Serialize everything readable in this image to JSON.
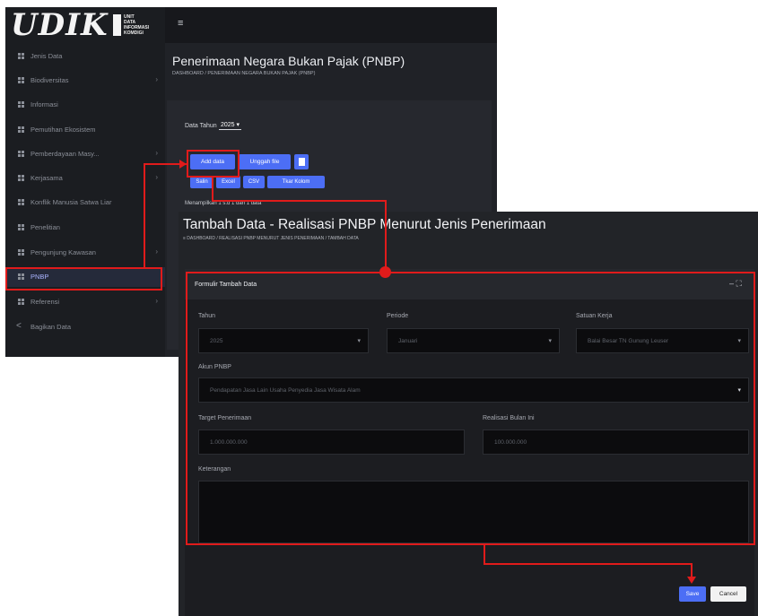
{
  "back": {
    "logo": {
      "text": "UDIK",
      "sub": [
        "UNIT",
        "DATA",
        "INFORMASI",
        "KOMDIGI"
      ]
    },
    "sidebar": {
      "items": [
        {
          "label": "Jenis Data",
          "icon": "grid-icon"
        },
        {
          "label": "Biodiversitas",
          "icon": "grid-icon",
          "chevron": "›"
        },
        {
          "label": "Informasi",
          "icon": "grid-icon"
        },
        {
          "label": "Pemutihan Ekosistem",
          "icon": "grid-icon"
        },
        {
          "label": "Pemberdayaan Masy...",
          "icon": "grid-icon",
          "chevron": "›"
        },
        {
          "label": "Kerjasama",
          "icon": "grid-icon",
          "chevron": "›"
        },
        {
          "label": "Konflik Manusia Satwa Liar",
          "icon": "grid-icon"
        },
        {
          "label": "Penelitian",
          "icon": "grid-icon"
        },
        {
          "label": "Pengunjung Kawasan",
          "icon": "grid-icon",
          "chevron": "›"
        },
        {
          "label": "PNBP",
          "icon": "grid-icon"
        },
        {
          "label": "Referensi",
          "icon": "grid-icon",
          "chevron": "›"
        },
        {
          "label": "Bagikan Data",
          "icon": "share-icon"
        }
      ]
    },
    "topbar": {
      "menu_icon": "≡"
    },
    "title": "Penerimaan Negara Bukan Pajak (PNBP)",
    "breadcrumb": "DASHBOARD  /  PENERIMAAN NEGARA BUKAN PAJAK (PNBP)",
    "year_label": "Data Tahun",
    "year_value": "2025 ▾",
    "buttons": {
      "add": "Add data",
      "upload": "Unggah file",
      "copy": "Salin",
      "excel": "Excel",
      "csv": "CSV",
      "columns": "Tkar Kolom"
    },
    "showing": "Menampilkan 1 s.d 1 dari 1 data"
  },
  "front": {
    "title": "Tambah Data - Realisasi PNBP Menurut Jenis Penerimaan",
    "breadcrumb": "≡ DASHBOARD  /  REALISASI PNBP MENURUT JENIS PENERIMAAN  /  TAMBAH DATA",
    "card_title": "Formulir Tambah Data",
    "card_controls": "– ⛶",
    "fields": {
      "tahun": {
        "label": "Tahun",
        "value": "2025"
      },
      "periode": {
        "label": "Periode",
        "value": "Januari"
      },
      "satuan_kerja": {
        "label": "Satuan Kerja",
        "value": "Balai Besar TN Gunung Leuser"
      },
      "akun": {
        "label": "Akun PNBP",
        "value": "Pendapatan Jasa Lain Usaha Penyedia Jasa Wisata Alam"
      },
      "target": {
        "label": "Target Penerimaan",
        "value": "1.000.000.000"
      },
      "realisasi": {
        "label": "Realisasi Bulan Ini",
        "value": "100.000.000"
      },
      "keterangan": {
        "label": "Keterangan",
        "value": ""
      }
    },
    "save": "Save",
    "cancel": "Cancel"
  },
  "colors": {
    "accent": "#4c6ef5",
    "annotation": "#e01b1b",
    "background_dark": "#202227"
  }
}
